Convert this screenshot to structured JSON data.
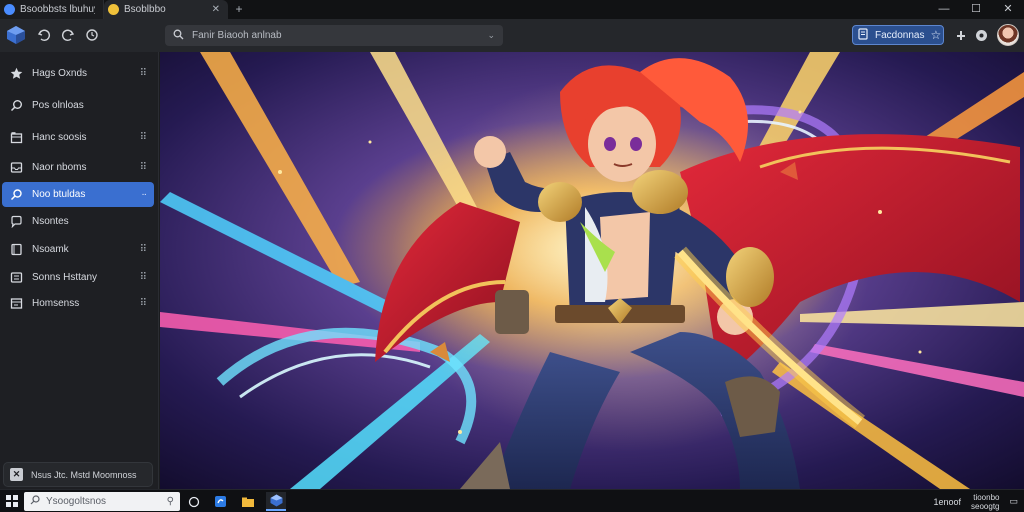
{
  "tabs": [
    {
      "title": "Bsoobbsts lbuhuys",
      "active": false,
      "favicon_color": "#4a8cff"
    },
    {
      "title": "Bsoblbbo",
      "active": true,
      "favicon_color": "#f0c13a"
    }
  ],
  "window_controls": {
    "minimize": "—",
    "maximize": "☐",
    "close": "✕"
  },
  "toolbar": {
    "address": "Fanir Biaooh anlnab",
    "pill_label": "Facdonnas",
    "icons": [
      "back-icon",
      "forward-icon",
      "refresh-icon",
      "extensions-icon",
      "profile-icon"
    ]
  },
  "sidebar": {
    "items": [
      {
        "label": "Hags Oxnds",
        "icon": "star-icon",
        "active": false
      },
      {
        "label": "Pos olnloas",
        "icon": "search-icon",
        "active": false
      },
      {
        "label": "Hanc soosis",
        "icon": "home-icon",
        "active": false
      },
      {
        "label": "Naor nboms",
        "icon": "inbox-icon",
        "active": false
      },
      {
        "label": "Noo btuldas",
        "icon": "pen-icon",
        "active": true
      },
      {
        "label": "Nsontes",
        "icon": "chat-icon",
        "active": false
      },
      {
        "label": "Nsoamk",
        "icon": "bookmark-icon",
        "active": false
      },
      {
        "label": "Sonns Hsttany",
        "icon": "history-icon",
        "active": false
      },
      {
        "label": "Homsenss",
        "icon": "folder-icon",
        "active": false
      }
    ],
    "more_glyph": "⠿",
    "profile": "Nsus Jtc. Mstd Moomnoss"
  },
  "taskbar": {
    "search_placeholder": "Ysoogoltsnos",
    "time": "1enoof",
    "date_line1": "tioonbo",
    "date_line2": "seoogtg"
  },
  "colors": {
    "accent": "#3a6fd0",
    "hair": "#e8402e",
    "cape": "#c9202e"
  }
}
